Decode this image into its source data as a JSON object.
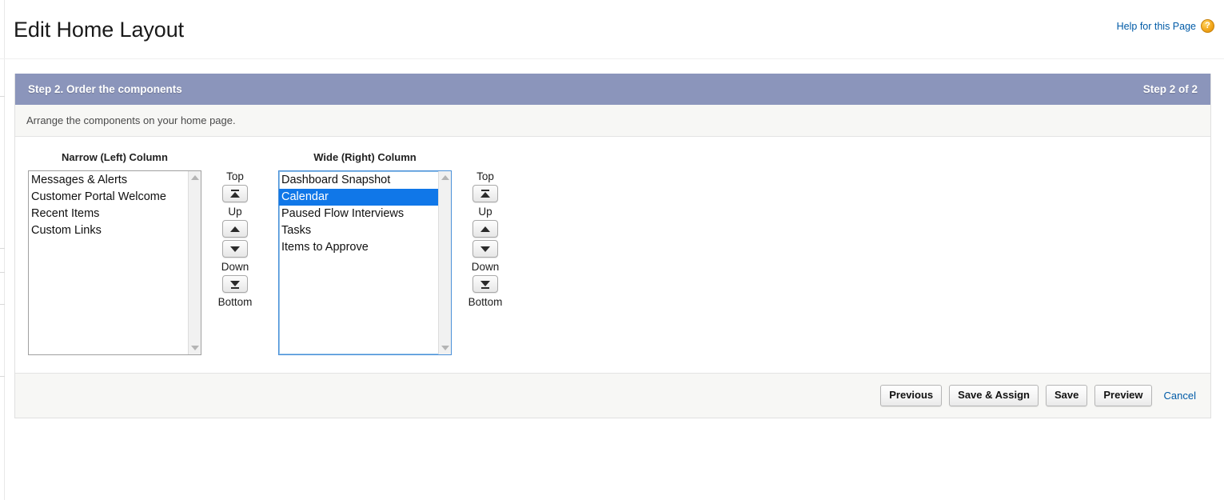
{
  "header": {
    "page_title": "Edit Home Layout",
    "help_link_label": "Help for this Page",
    "help_icon_glyph": "?"
  },
  "step_panel": {
    "step_title": "Step 2. Order the components",
    "step_count": "Step 2 of 2",
    "description": "Arrange the components on your home page."
  },
  "narrow_column": {
    "label": "Narrow (Left) Column",
    "focused": false,
    "items": [
      {
        "label": "Messages & Alerts",
        "selected": false
      },
      {
        "label": "Customer Portal Welcome",
        "selected": false
      },
      {
        "label": "Recent Items",
        "selected": false
      },
      {
        "label": "Custom Links",
        "selected": false
      }
    ]
  },
  "wide_column": {
    "label": "Wide (Right) Column",
    "focused": true,
    "items": [
      {
        "label": "Dashboard Snapshot",
        "selected": false
      },
      {
        "label": "Calendar",
        "selected": true
      },
      {
        "label": "Paused Flow Interviews",
        "selected": false
      },
      {
        "label": "Tasks",
        "selected": false
      },
      {
        "label": "Items to Approve",
        "selected": false
      }
    ]
  },
  "move_controls": {
    "top_label": "Top",
    "up_label": "Up",
    "down_label": "Down",
    "bottom_label": "Bottom"
  },
  "footer": {
    "previous_label": "Previous",
    "save_assign_label": "Save & Assign",
    "save_label": "Save",
    "preview_label": "Preview",
    "cancel_label": "Cancel"
  },
  "colors": {
    "step_header_bg": "#8b95bb",
    "selection_blue": "#1077e8",
    "link_blue": "#015ba7",
    "help_icon_gold": "#f3a81c",
    "panel_bg": "#f7f7f5"
  }
}
